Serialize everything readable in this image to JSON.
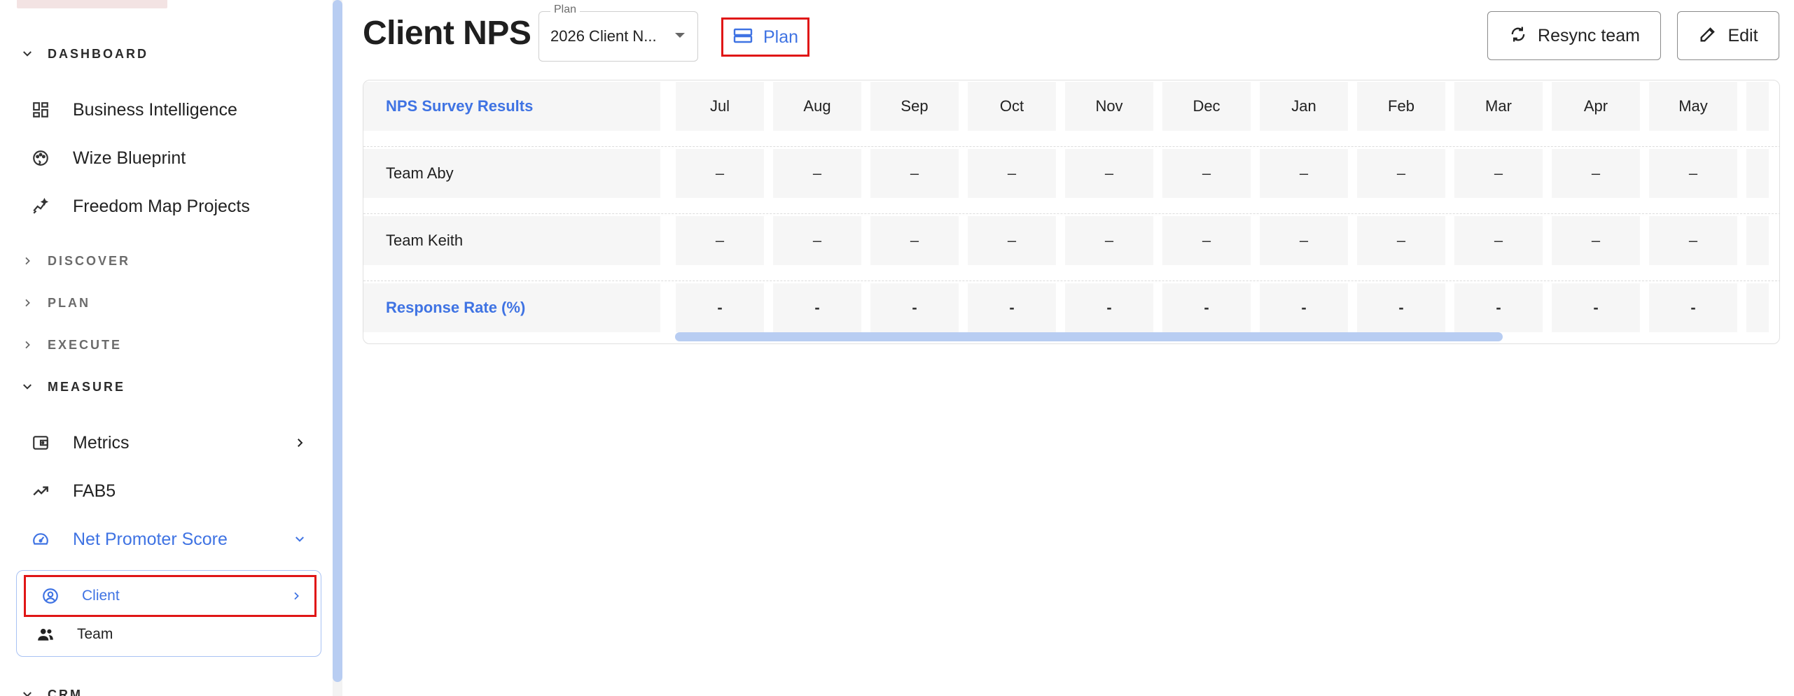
{
  "sidebar": {
    "sections": [
      {
        "label": "DASHBOARD",
        "expanded": true
      },
      {
        "label": "DISCOVER",
        "expanded": false
      },
      {
        "label": "PLAN",
        "expanded": false
      },
      {
        "label": "EXECUTE",
        "expanded": false
      },
      {
        "label": "MEASURE",
        "expanded": true
      },
      {
        "label": "CRM",
        "expanded": true
      }
    ],
    "dashboard_items": [
      {
        "label": "Business Intelligence",
        "icon": "dashboard-grid-icon"
      },
      {
        "label": "Wize Blueprint",
        "icon": "palette-icon"
      },
      {
        "label": "Freedom Map Projects",
        "icon": "sparkle-chart-icon"
      }
    ],
    "measure_items": [
      {
        "label": "Metrics",
        "icon": "wallet-icon"
      },
      {
        "label": "FAB5",
        "icon": "trending-up-icon"
      },
      {
        "label": "Net Promoter Score",
        "icon": "speedometer-icon"
      }
    ],
    "nps_submenu": [
      {
        "label": "Client",
        "icon": "user-circle-icon"
      },
      {
        "label": "Team",
        "icon": "people-icon"
      }
    ]
  },
  "header": {
    "title": "Client NPS",
    "plan_select": {
      "legend": "Plan",
      "value": "2026 Client N..."
    },
    "plan_button": "Plan",
    "resync_button": "Resync team",
    "edit_button": "Edit"
  },
  "table": {
    "columns": [
      "Jul",
      "Aug",
      "Sep",
      "Oct",
      "Nov",
      "Dec",
      "Jan",
      "Feb",
      "Mar",
      "Apr",
      "May"
    ],
    "header_label": "NPS Survey Results",
    "rows": [
      {
        "label": "Team Aby",
        "values": [
          "–",
          "–",
          "–",
          "–",
          "–",
          "–",
          "–",
          "–",
          "–",
          "–",
          "–"
        ]
      },
      {
        "label": "Team Keith",
        "values": [
          "–",
          "–",
          "–",
          "–",
          "–",
          "–",
          "–",
          "–",
          "–",
          "–",
          "–"
        ]
      }
    ],
    "footer": {
      "label": "Response Rate (%)",
      "values": [
        "-",
        "-",
        "-",
        "-",
        "-",
        "-",
        "-",
        "-",
        "-",
        "-",
        "-"
      ]
    }
  },
  "colors": {
    "accent": "#3f73e3",
    "highlight": "#e01616",
    "scroll": "#b8cdf2"
  }
}
